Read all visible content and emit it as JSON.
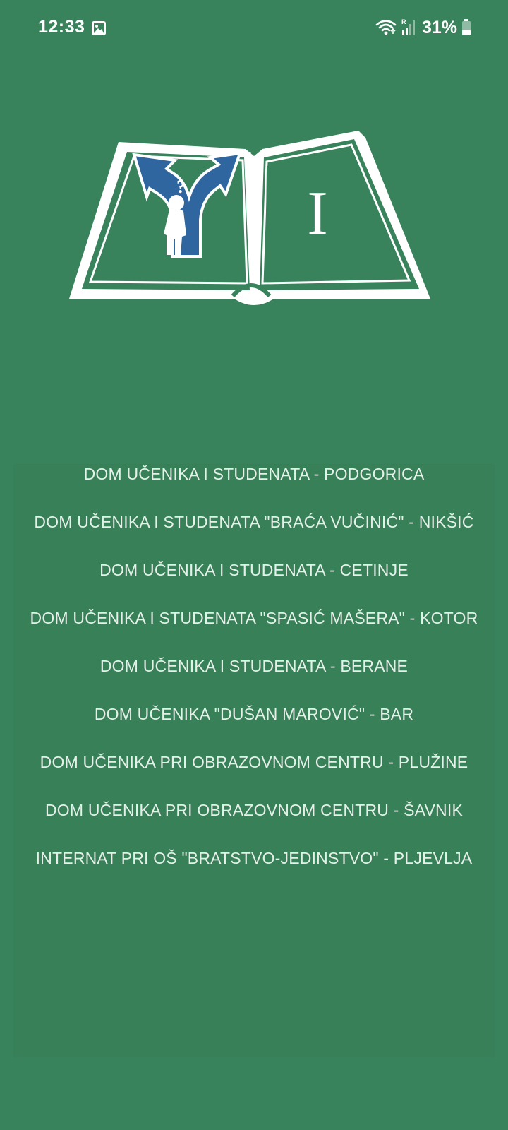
{
  "status_bar": {
    "time": "12:33",
    "battery": "31%",
    "icons": [
      "gallery-icon",
      "wifi-icon",
      "signal-icon",
      "battery-icon"
    ]
  },
  "logo": {
    "page_letter": "I",
    "book_color": "#ffffff",
    "arrow_color": "#2F66A0"
  },
  "dorms": [
    {
      "label": "DOM UČENIKA I STUDENATA - PODGORICA"
    },
    {
      "label": "DOM UČENIKA I STUDENATA \"BRAĆA VUČINIĆ\" - NIKŠIĆ"
    },
    {
      "label": "DOM UČENIKA I STUDENATA - CETINJE"
    },
    {
      "label": "DOM UČENIKA I STUDENATA \"SPASIĆ MAŠERA\" - KOTOR"
    },
    {
      "label": "DOM UČENIKA I STUDENATA - BERANE"
    },
    {
      "label": "DOM UČENIKA \"DUŠAN MAROVIĆ\" - BAR"
    },
    {
      "label": "DOM UČENIKA PRI OBRAZOVNOM CENTRU - PLUŽINE"
    },
    {
      "label": "DOM UČENIKA PRI OBRAZOVNOM CENTRU - ŠAVNIK"
    },
    {
      "label": "INTERNAT PRI OŠ \"BRATSTVO-JEDINSTVO\" - PLJEVLJA"
    }
  ],
  "colors": {
    "background": "#38825C",
    "list_background": "#378058",
    "item_text": "#E6EFE9"
  }
}
